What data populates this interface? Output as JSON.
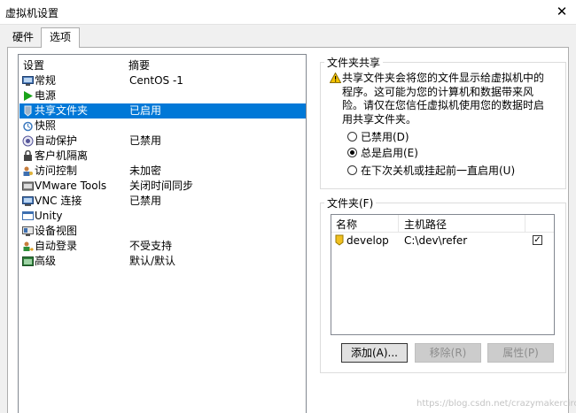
{
  "window": {
    "title": "虚拟机设置",
    "close_glyph": "✕"
  },
  "tabs": [
    {
      "label": "硬件",
      "active": false
    },
    {
      "label": "选项",
      "active": true
    }
  ],
  "settings": {
    "col_setting": "设置",
    "col_summary": "摘要",
    "items": [
      {
        "name": "常规",
        "summary": "CentOS -1",
        "icon": "general-icon"
      },
      {
        "name": "电源",
        "summary": "",
        "icon": "power-icon"
      },
      {
        "name": "共享文件夹",
        "summary": "已启用",
        "icon": "shared-folder-icon",
        "selected": true
      },
      {
        "name": "快照",
        "summary": "",
        "icon": "snapshot-icon"
      },
      {
        "name": "自动保护",
        "summary": "已禁用",
        "icon": "autoprotect-icon"
      },
      {
        "name": "客户机隔离",
        "summary": "",
        "icon": "isolation-icon"
      },
      {
        "name": "访问控制",
        "summary": "未加密",
        "icon": "access-control-icon"
      },
      {
        "name": "VMware Tools",
        "summary": "关闭时间同步",
        "icon": "vmware-tools-icon"
      },
      {
        "name": "VNC 连接",
        "summary": "已禁用",
        "icon": "vnc-icon"
      },
      {
        "name": "Unity",
        "summary": "",
        "icon": "unity-icon"
      },
      {
        "name": "设备视图",
        "summary": "",
        "icon": "device-view-icon"
      },
      {
        "name": "自动登录",
        "summary": "不受支持",
        "icon": "autologin-icon"
      },
      {
        "name": "高级",
        "summary": "默认/默认",
        "icon": "advanced-icon"
      }
    ]
  },
  "folder_sharing": {
    "title": "文件夹共享",
    "warning": "共享文件夹会将您的文件显示给虚拟机中的程序。这可能为您的计算机和数据带来风险。请仅在您信任虚拟机使用您的数据时启用共享文件夹。",
    "options": [
      {
        "label": "已禁用(D)",
        "checked": false
      },
      {
        "label": "总是启用(E)",
        "checked": true
      },
      {
        "label": "在下次关机或挂起前一直启用(U)",
        "checked": false
      }
    ]
  },
  "folders": {
    "title": "文件夹(F)",
    "col_name": "名称",
    "col_path": "主机路径",
    "rows": [
      {
        "name": "develop",
        "path": "C:\\dev\\refer",
        "enabled": true
      }
    ],
    "buttons": {
      "add": "添加(A)...",
      "remove": "移除(R)",
      "properties": "属性(P)"
    }
  },
  "colors": {
    "selection": "#0078d7",
    "play_green": "#1aa31a",
    "warning_yellow": "#f5c400"
  },
  "watermark": "https://blog.csdn.net/crazymakercircle"
}
